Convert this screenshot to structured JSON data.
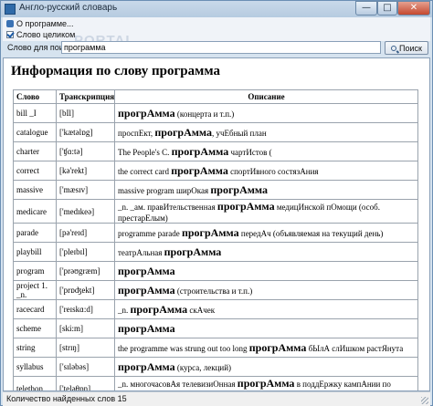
{
  "window": {
    "title": "Англо-русский словарь",
    "minimize": "—",
    "maximize": "□",
    "close": "✕"
  },
  "menu": {
    "about": "О программе...",
    "whole_word": "Слово целиком"
  },
  "watermark": "PORTAL",
  "search": {
    "label": "Слово для поиска:",
    "value": "программа",
    "button": "Поиск"
  },
  "content": {
    "title": "Информация по слову программа"
  },
  "table": {
    "headers": {
      "word": "Слово",
      "transcription": "Транскрипция",
      "description": "Описание"
    },
    "rows": [
      {
        "word": "bill _I",
        "transcription": "[bIl]",
        "desc": [
          {
            "t": "прогрАмма",
            "b": true
          },
          {
            "t": " (концерта и т.п.)",
            "b": false
          }
        ]
      },
      {
        "word": "catalogue",
        "transcription": "['kætəlɒg]",
        "desc": [
          {
            "t": "проспЕкт, ",
            "b": false
          },
          {
            "t": "прогрАмма",
            "b": true
          },
          {
            "t": ", учЕбный план",
            "b": false
          }
        ]
      },
      {
        "word": "charter",
        "transcription": "['ʧɑ:tə]",
        "desc": [
          {
            "t": "The People's С. ",
            "b": false
          },
          {
            "t": "прогрАмма",
            "b": true
          },
          {
            "t": " чартИстов (",
            "b": false
          }
        ]
      },
      {
        "word": "correct",
        "transcription": "[kə'rekt]",
        "desc": [
          {
            "t": "the correct card ",
            "b": false
          },
          {
            "t": "прогрАмма",
            "b": true
          },
          {
            "t": " спортИвного состязАния",
            "b": false
          }
        ]
      },
      {
        "word": "massive",
        "transcription": "['mæsɪv]",
        "desc": [
          {
            "t": "massive program ширОкая ",
            "b": false
          },
          {
            "t": "прогрАмма",
            "b": true
          }
        ]
      },
      {
        "word": "medicare",
        "transcription": "['medɪkeə]",
        "desc": [
          {
            "t": "_n. _ам. правИтельственная ",
            "b": false
          },
          {
            "t": "прогрАмма",
            "b": true
          },
          {
            "t": " медицИнской пОмощи (особ. престарЕлым)",
            "b": false
          }
        ]
      },
      {
        "word": "parade",
        "transcription": "[pə'reɪd]",
        "desc": [
          {
            "t": "programme parade ",
            "b": false
          },
          {
            "t": "прогрАмма",
            "b": true
          },
          {
            "t": " передАч (объявляемая на текущий день)",
            "b": false
          }
        ]
      },
      {
        "word": "playbill",
        "transcription": "['pleɪbɪl]",
        "desc": [
          {
            "t": "театрАльная ",
            "b": false
          },
          {
            "t": "прогрАмма",
            "b": true
          }
        ]
      },
      {
        "word": "program",
        "transcription": "['prəʊgræm]",
        "desc": [
          {
            "t": "прогрАмма",
            "b": true
          }
        ]
      },
      {
        "word": "project 1. _n.",
        "transcription": "['prɒʤekt]",
        "desc": [
          {
            "t": "прогрАмма",
            "b": true
          },
          {
            "t": " (строительства и т.п.)",
            "b": false
          }
        ]
      },
      {
        "word": "racecard",
        "transcription": "['reɪskɑ:d]",
        "desc": [
          {
            "t": "_n. ",
            "b": false
          },
          {
            "t": "прогрАмма",
            "b": true
          },
          {
            "t": " скАчек",
            "b": false
          }
        ]
      },
      {
        "word": "scheme",
        "transcription": "[ski:m]",
        "desc": [
          {
            "t": "прогрАмма",
            "b": true
          }
        ]
      },
      {
        "word": "string",
        "transcription": "[strɪŋ]",
        "desc": [
          {
            "t": "the programme was strung out too long ",
            "b": false
          },
          {
            "t": "прогрАмма",
            "b": true
          },
          {
            "t": " бЫлА слИшком растЯнута",
            "b": false
          }
        ]
      },
      {
        "word": "syllabus",
        "transcription": "['sɪləbəs]",
        "desc": [
          {
            "t": "прогрАмма",
            "b": true
          },
          {
            "t": " (курса, лекций)",
            "b": false
          }
        ]
      },
      {
        "word": "telethon",
        "transcription": "['teləθɒn]",
        "desc": [
          {
            "t": "_n. многочасовАя телевизиОнная ",
            "b": false
          },
          {
            "t": "прогрАмма",
            "b": true
          },
          {
            "t": " в поддЕржку кампАнии по сбОру средств или предвЫборной кампАнии",
            "b": false
          }
        ]
      }
    ]
  },
  "status": {
    "text": "Количество найденных слов 15"
  }
}
